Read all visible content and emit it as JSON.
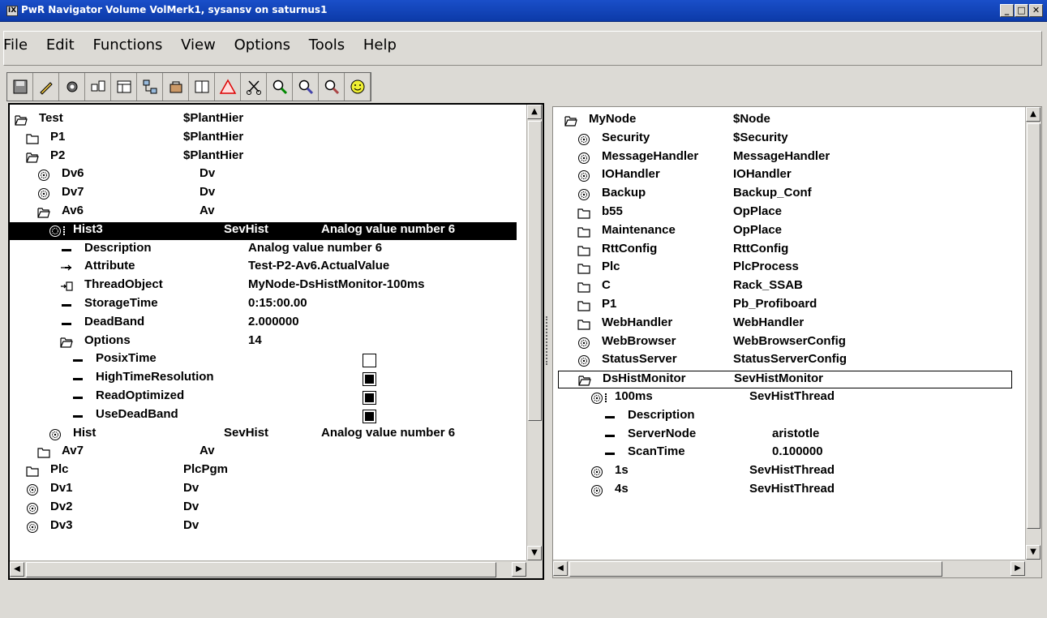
{
  "window": {
    "title": "PwR Navigator Volume VolMerk1, sysansv on saturnus1",
    "icon_label": "IX",
    "minimize": "_",
    "maximize": "□",
    "close": "✕"
  },
  "menu": [
    "File",
    "Edit",
    "Functions",
    "View",
    "Options",
    "Tools",
    "Help"
  ],
  "toolbar": [
    {
      "name": "save-icon"
    },
    {
      "name": "edit-pen-icon"
    },
    {
      "name": "gear-icon"
    },
    {
      "name": "class-icon"
    },
    {
      "name": "window-icon"
    },
    {
      "name": "tree-icon"
    },
    {
      "name": "box-icon"
    },
    {
      "name": "split-icon"
    },
    {
      "name": "warning-icon"
    },
    {
      "name": "scissors-icon"
    },
    {
      "name": "search-icon"
    },
    {
      "name": "search-next-icon"
    },
    {
      "name": "search-plant-icon"
    },
    {
      "name": "smiley-icon"
    }
  ],
  "left_tree": [
    {
      "level": 0,
      "icon": "folder-open",
      "name": "Test",
      "class": "$PlantHier"
    },
    {
      "level": 1,
      "icon": "folder",
      "name": "P1",
      "class": "$PlantHier"
    },
    {
      "level": 1,
      "icon": "folder-open",
      "name": "P2",
      "class": "$PlantHier"
    },
    {
      "level": 2,
      "icon": "object",
      "name": "Dv6",
      "class": "Dv"
    },
    {
      "level": 2,
      "icon": "object",
      "name": "Dv7",
      "class": "Dv"
    },
    {
      "level": 2,
      "icon": "folder-open",
      "name": "Av6",
      "class": "Av"
    },
    {
      "level": 3,
      "icon": "object-open",
      "name": "Hist3",
      "class": "SevHist",
      "desc": "Analog value number 6",
      "selected": true
    },
    {
      "level": 4,
      "icon": "attr",
      "name": "Description",
      "value": "Analog value number 6"
    },
    {
      "level": 4,
      "icon": "attr-ref",
      "name": "Attribute",
      "value": "Test-P2-Av6.ActualValue"
    },
    {
      "level": 4,
      "icon": "attr-obj",
      "name": "ThreadObject",
      "value": "MyNode-DsHistMonitor-100ms"
    },
    {
      "level": 4,
      "icon": "attr",
      "name": "StorageTime",
      "value": "0:15:00.00"
    },
    {
      "level": 4,
      "icon": "attr",
      "name": "DeadBand",
      "value": "2.000000"
    },
    {
      "level": 4,
      "icon": "folder-open",
      "name": "Options",
      "value": "14"
    },
    {
      "level": 5,
      "icon": "attr",
      "name": "PosixTime",
      "checked": false
    },
    {
      "level": 5,
      "icon": "attr",
      "name": "HighTimeResolution",
      "checked": true
    },
    {
      "level": 5,
      "icon": "attr",
      "name": "ReadOptimized",
      "checked": true
    },
    {
      "level": 5,
      "icon": "attr",
      "name": "UseDeadBand",
      "checked": true
    },
    {
      "level": 3,
      "icon": "object",
      "name": "Hist",
      "class": "SevHist",
      "desc": "Analog value number 6"
    },
    {
      "level": 2,
      "icon": "folder",
      "name": "Av7",
      "class": "Av"
    },
    {
      "level": 1,
      "icon": "folder",
      "name": "Plc",
      "class": "PlcPgm"
    },
    {
      "level": 1,
      "icon": "object",
      "name": "Dv1",
      "class": "Dv"
    },
    {
      "level": 1,
      "icon": "object",
      "name": "Dv2",
      "class": "Dv"
    },
    {
      "level": 1,
      "icon": "object",
      "name": "Dv3",
      "class": "Dv"
    }
  ],
  "right_tree": [
    {
      "level": 0,
      "icon": "folder-open",
      "name": "MyNode",
      "class": "$Node"
    },
    {
      "level": 1,
      "icon": "object",
      "name": "Security",
      "class": "$Security"
    },
    {
      "level": 1,
      "icon": "object",
      "name": "MessageHandler",
      "class": "MessageHandler"
    },
    {
      "level": 1,
      "icon": "object",
      "name": "IOHandler",
      "class": "IOHandler"
    },
    {
      "level": 1,
      "icon": "object",
      "name": "Backup",
      "class": "Backup_Conf"
    },
    {
      "level": 1,
      "icon": "folder",
      "name": "b55",
      "class": "OpPlace"
    },
    {
      "level": 1,
      "icon": "folder",
      "name": "Maintenance",
      "class": "OpPlace"
    },
    {
      "level": 1,
      "icon": "folder",
      "name": "RttConfig",
      "class": "RttConfig"
    },
    {
      "level": 1,
      "icon": "folder",
      "name": "Plc",
      "class": "PlcProcess"
    },
    {
      "level": 1,
      "icon": "folder",
      "name": "C",
      "class": "Rack_SSAB"
    },
    {
      "level": 1,
      "icon": "folder",
      "name": "P1",
      "class": "Pb_Profiboard"
    },
    {
      "level": 1,
      "icon": "folder",
      "name": "WebHandler",
      "class": "WebHandler"
    },
    {
      "level": 1,
      "icon": "object",
      "name": "WebBrowser",
      "class": "WebBrowserConfig"
    },
    {
      "level": 1,
      "icon": "object",
      "name": "StatusServer",
      "class": "StatusServerConfig"
    },
    {
      "level": 1,
      "icon": "folder-open",
      "name": "DsHistMonitor",
      "class": "SevHistMonitor",
      "framed": true
    },
    {
      "level": 2,
      "icon": "object-open",
      "name": "100ms",
      "class": "SevHistThread"
    },
    {
      "level": 3,
      "icon": "attr",
      "name": "Description",
      "value": ""
    },
    {
      "level": 3,
      "icon": "attr",
      "name": "ServerNode",
      "value": "aristotle"
    },
    {
      "level": 3,
      "icon": "attr",
      "name": "ScanTime",
      "value": "0.100000"
    },
    {
      "level": 2,
      "icon": "object",
      "name": "1s",
      "class": "SevHistThread"
    },
    {
      "level": 2,
      "icon": "object",
      "name": "4s",
      "class": "SevHistThread"
    }
  ],
  "scroll_arrows": {
    "up": "▲",
    "down": "▼",
    "left": "◀",
    "right": "▶"
  }
}
